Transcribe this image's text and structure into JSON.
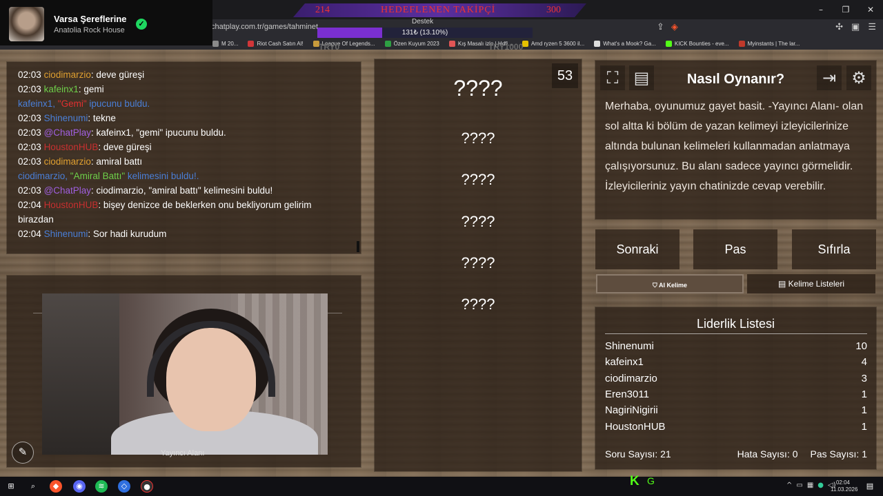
{
  "now_playing": {
    "title": "Varsa Şereflerine",
    "artist": "Anatolia Rock House"
  },
  "goal": {
    "current": "214",
    "label": "HEDEFLENEN TAKİPÇİ",
    "target": "300"
  },
  "support": {
    "label": "Destek",
    "progress_text": "131₺ (13.10%)",
    "progress": 0.131,
    "trk_min": "TRY0",
    "trk_max": "TRY1000"
  },
  "browser": {
    "url": "chatplay.com.tr/games/tahminet",
    "window_controls": [
      "–",
      "❐",
      "✕"
    ],
    "bookmarks": [
      {
        "label": "M 20...",
        "color": "#8a8a8a"
      },
      {
        "label": "Riot Cash Satın Al!",
        "color": "#d13639"
      },
      {
        "label": "League Of Legends...",
        "color": "#c89b3c"
      },
      {
        "label": "Özen Kuyum 2023",
        "color": "#2ea043"
      },
      {
        "label": "Kış Masalı izle | Hdfi...",
        "color": "#e05555"
      },
      {
        "label": "Amd ryzen 5 3600 il...",
        "color": "#e5c100"
      },
      {
        "label": "What's a Mook? Ga...",
        "color": "#dddddd"
      },
      {
        "label": "KICK Bounties - eve...",
        "color": "#53fc18"
      },
      {
        "label": "Myinstants | The lar...",
        "color": "#c0392b"
      }
    ]
  },
  "chat": {
    "lines": [
      {
        "time": "02:03",
        "user": "ciodimarzio",
        "user_color": "#e0a030",
        "text": ": deve güreşi"
      },
      {
        "time": "02:03",
        "user": "kafeinx1",
        "user_color": "#6ed04a",
        "text": ": gemi"
      },
      {
        "time": "",
        "user": "kafeinx1, ",
        "user_color": "#4a7fd8",
        "highlight": "\"Gemi\"",
        "highlight_color": "#e03030",
        "text": " ipucunu buldu.",
        "text_color": "#4a7fd8"
      },
      {
        "time": "02:03",
        "user": "Shinenumi",
        "user_color": "#4a7fd8",
        "text": ": tekne"
      },
      {
        "time": "02:03",
        "user": "@ChatPlay",
        "user_color": "#a05fe0",
        "text": ": kafeinx1, \"gemi\" ipucunu buldu."
      },
      {
        "time": "02:03",
        "user": "HoustonHUB",
        "user_color": "#c83030",
        "text": ": deve güreşi"
      },
      {
        "time": "02:03",
        "user": "ciodimarzio",
        "user_color": "#e0a030",
        "text": ": amiral battı"
      },
      {
        "time": "",
        "user": "ciodimarzio, ",
        "user_color": "#4a7fd8",
        "highlight": "\"Amiral Battı\"",
        "highlight_color": "#6ed04a",
        "text": " kelimesini buldu!.",
        "text_color": "#4a7fd8"
      },
      {
        "time": "02:03",
        "user": "@ChatPlay",
        "user_color": "#a05fe0",
        "text": ": ciodimarzio, \"amiral battı\" kelimesini buldu!"
      },
      {
        "time": "02:04",
        "user": "HoustonHUB",
        "user_color": "#c83030",
        "text": ": bişey denizce de beklerken onu bekliyorum gelirim birazdan"
      },
      {
        "time": "02:04",
        "user": "Shinenumi",
        "user_color": "#4a7fd8",
        "text": ": Sor hadi kurudum"
      }
    ]
  },
  "camera": {
    "label": "Yayıncı Alanı",
    "mic_icon": "✎"
  },
  "game": {
    "counter": "53",
    "main_word": "????",
    "words": [
      "????",
      "????",
      "????",
      "????",
      "????"
    ]
  },
  "help": {
    "title": "Nasıl Oynanır?",
    "text": "Merhaba, oyunumuz gayet basit. -Yayıncı Alanı- olan sol altta ki bölüm de yazan kelimeyi izleyicilerinize altında bulunan kelimeleri kullanmadan anlatmaya çalışıyorsunuz. Bu alanı sadece yayıncı görmelidir. İzleyicileriniz yayın chatinizde cevap verebilir."
  },
  "buttons": {
    "next": "Sonraki",
    "pass": "Pas",
    "reset": "Sıfırla",
    "ai": "⛉ AI Kelime",
    "lists": "▤ Kelime Listeleri"
  },
  "leaderboard": {
    "title": "Liderlik Listesi",
    "rows": [
      {
        "name": "Shinenumi",
        "score": "10"
      },
      {
        "name": "kafeinx1",
        "score": "4"
      },
      {
        "name": "ciodimarzio",
        "score": "3"
      },
      {
        "name": "Eren3011",
        "score": "1"
      },
      {
        "name": "NagiriNigirii",
        "score": "1"
      },
      {
        "name": "HoustonHUB",
        "score": "1"
      }
    ],
    "question_count": "Soru Sayısı: 21",
    "error_count": "Hata Sayısı: 0",
    "pass_count": "Pas Sayısı: 1"
  },
  "taskbar": {
    "time": "02:04",
    "date": "11.03.2026"
  }
}
